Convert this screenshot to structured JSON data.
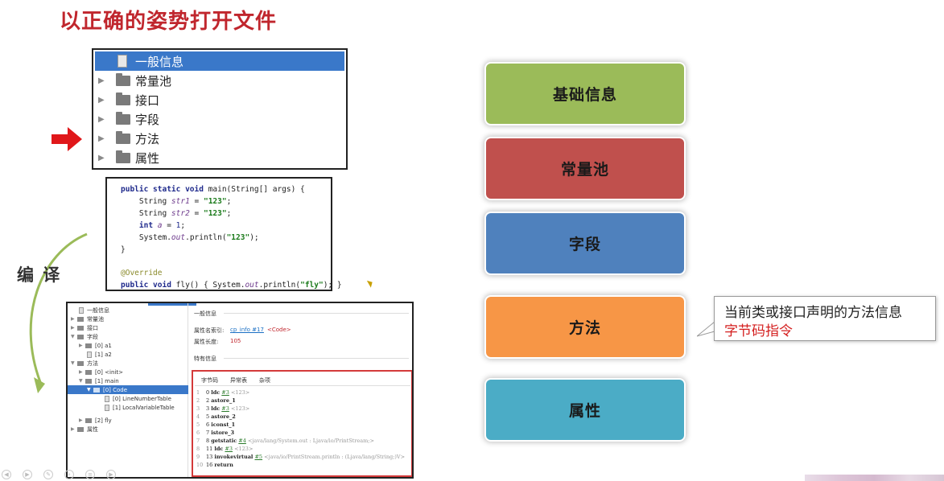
{
  "slide": {
    "title": "以正确的姿势打开文件",
    "compile_label": "编 译"
  },
  "tree": {
    "items": [
      {
        "label": "一般信息",
        "icon": "document-icon",
        "selected": true
      },
      {
        "label": "常量池",
        "icon": "folder-icon"
      },
      {
        "label": "接口",
        "icon": "folder-icon"
      },
      {
        "label": "字段",
        "icon": "folder-icon"
      },
      {
        "label": "方法",
        "icon": "folder-icon"
      },
      {
        "label": "属性",
        "icon": "folder-icon"
      }
    ]
  },
  "code": {
    "lines": [
      {
        "t1": "public static void ",
        "t2": "main(String[] args) {"
      },
      {
        "p1": "    String ",
        "p2": "str1",
        "p3": " = ",
        "p4": "\"123\"",
        "p5": ";"
      },
      {
        "p1": "    String ",
        "p2": "str2",
        "p3": " = ",
        "p4": "\"123\"",
        "p5": ";"
      },
      {
        "p1": "    int ",
        "p2": "a",
        "p3": " = ",
        "p4": "1",
        "p5": ";"
      },
      {
        "p1": "    System.",
        "p2": "out",
        "p3": ".println(",
        "p4": "\"123\"",
        "p5": ");"
      },
      {
        "p1": "}"
      },
      {
        "p1": "@Override"
      },
      {
        "p1": "public void ",
        "p2": "fly() { System.",
        "p3": "out",
        "p4": ".println(",
        "p5": "\"fly\"",
        "p6": "); }"
      }
    ]
  },
  "ide": {
    "tree": [
      {
        "label": "一般信息",
        "kind": "doc",
        "indent": 0
      },
      {
        "label": "常量池",
        "kind": "folder",
        "indent": 0,
        "arrow": "▶"
      },
      {
        "label": "接口",
        "kind": "folder",
        "indent": 0,
        "arrow": "▶"
      },
      {
        "label": "字段",
        "kind": "folder",
        "indent": 0,
        "arrow": "▼"
      },
      {
        "label": "[0] a1",
        "kind": "folder",
        "indent": 1,
        "arrow": "▶"
      },
      {
        "label": "[1] a2",
        "kind": "doc",
        "indent": 1
      },
      {
        "label": "方法",
        "kind": "folder",
        "indent": 0,
        "arrow": "▼"
      },
      {
        "label": "[0] <init>",
        "kind": "folder",
        "indent": 1,
        "arrow": "▶"
      },
      {
        "label": "[1] main",
        "kind": "folder",
        "indent": 1,
        "arrow": "▼"
      },
      {
        "label": "[0] Code",
        "kind": "folder",
        "indent": 2,
        "arrow": "▼",
        "selected": true
      },
      {
        "label": "[0] LineNumberTable",
        "kind": "doc",
        "indent": 3
      },
      {
        "label": "[1] LocalVariableTable",
        "kind": "doc",
        "indent": 3
      },
      {
        "label": "[2] fly",
        "kind": "folder",
        "indent": 1,
        "arrow": "▶"
      },
      {
        "label": "属性",
        "kind": "folder",
        "indent": 0,
        "arrow": "▶"
      }
    ],
    "general_header": "一般信息",
    "attr_name_label": "属性名索引:",
    "attr_name_link": "cp_info #17",
    "attr_name_value": "<Code>",
    "attr_len_label": "属性长度:",
    "attr_len_value": "105",
    "special_header": "特有信息",
    "tabs": [
      "字节码",
      "异常表",
      "杂项"
    ],
    "bytecode": [
      {
        "n": "1",
        "off": "0",
        "op": "ldc",
        "ref": "#3",
        "cm": "<123>"
      },
      {
        "n": "2",
        "off": "2",
        "op": "astore_1",
        "ref": "",
        "cm": ""
      },
      {
        "n": "3",
        "off": "3",
        "op": "ldc",
        "ref": "#3",
        "cm": "<123>"
      },
      {
        "n": "4",
        "off": "5",
        "op": "astore_2",
        "ref": "",
        "cm": ""
      },
      {
        "n": "5",
        "off": "6",
        "op": "iconst_1",
        "ref": "",
        "cm": ""
      },
      {
        "n": "6",
        "off": "7",
        "op": "istore_3",
        "ref": "",
        "cm": ""
      },
      {
        "n": "7",
        "off": "8",
        "op": "getstatic",
        "ref": "#4",
        "cm": "<java/lang/System.out : Ljava/io/PrintStream;>"
      },
      {
        "n": "8",
        "off": "11",
        "op": "ldc",
        "ref": "#3",
        "cm": "<123>"
      },
      {
        "n": "9",
        "off": "13",
        "op": "invokevirtual",
        "ref": "#5",
        "cm": "<java/io/PrintStream.println : (Ljava/lang/String;)V>"
      },
      {
        "n": "10",
        "off": "16",
        "op": "return",
        "ref": "",
        "cm": ""
      }
    ]
  },
  "sections": [
    {
      "label": "基础信息",
      "color": "#9bbb59"
    },
    {
      "label": "常量池",
      "color": "#c0504d"
    },
    {
      "label": "字段",
      "color": "#4f81bd"
    },
    {
      "label": "方法",
      "color": "#f79646"
    },
    {
      "label": "属性",
      "color": "#4bacc6"
    }
  ],
  "callout": {
    "line1": "当前类或接口声明的方法信息",
    "line2": "字节码指令"
  }
}
